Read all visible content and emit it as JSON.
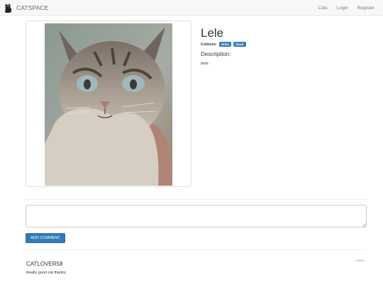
{
  "navbar": {
    "brand": "CATSPACE",
    "links": [
      {
        "label": "Cats"
      },
      {
        "label": "Login"
      },
      {
        "label": "Register"
      }
    ]
  },
  "cat": {
    "name": "Lele",
    "colours_label": "Colours:",
    "colours": [
      "white",
      "black"
    ],
    "description_heading": "Description:",
    "description": "farts",
    "photo": "cat-photo"
  },
  "comment_form": {
    "placeholder": "",
    "button_label": "ADD COMMENT"
  },
  "comments": [
    {
      "author": "CATLOVER58",
      "date": "today",
      "text": "Really good cat thanks."
    }
  ],
  "colors": {
    "accent": "#337ab7",
    "navbar_bg": "#f8f8f8"
  }
}
